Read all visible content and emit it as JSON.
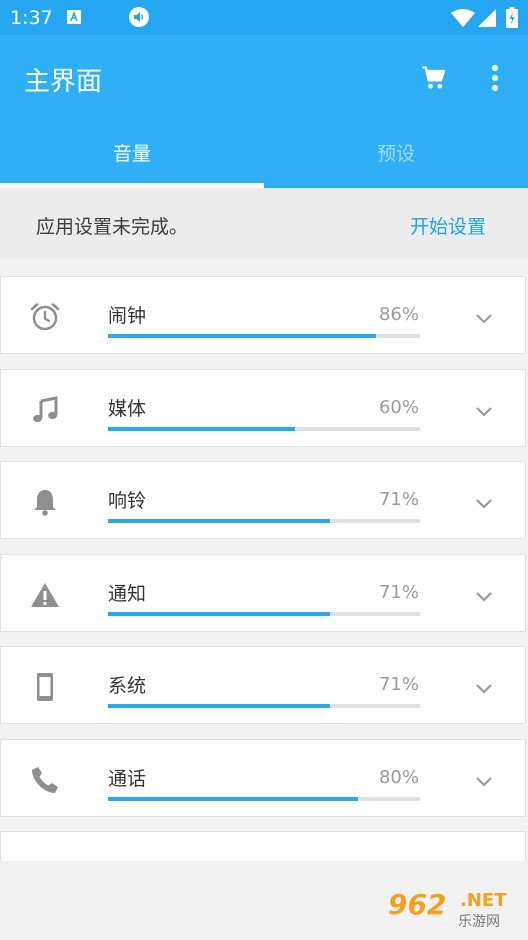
{
  "status_bar": {
    "time": "1:37",
    "accent": "#25a6f0",
    "icons": [
      "a-notification-icon",
      "volume-icon",
      "wifi-icon",
      "signal-icon",
      "battery-icon"
    ]
  },
  "app_bar": {
    "title": "主界面",
    "accent": "#2fb0f6",
    "actions": [
      "cart-icon",
      "more-vert-icon"
    ]
  },
  "tabs": [
    {
      "label": "音量",
      "selected": true
    },
    {
      "label": "预设",
      "selected": false
    }
  ],
  "setup_banner": {
    "message": "应用设置未完成。",
    "action": "开始设置"
  },
  "volume_items": [
    {
      "label": "闹钟",
      "percent_text": "86%",
      "level": 0.86,
      "icon": "alarm-icon"
    },
    {
      "label": "媒体",
      "percent_text": "60%",
      "level": 0.6,
      "icon": "music-note-icon"
    },
    {
      "label": "响铃",
      "percent_text": "71%",
      "level": 0.71,
      "icon": "bell-icon"
    },
    {
      "label": "通知",
      "percent_text": "71%",
      "level": 0.71,
      "icon": "warning-icon"
    },
    {
      "label": "系统",
      "percent_text": "71%",
      "level": 0.71,
      "icon": "phone-device-icon"
    },
    {
      "label": "通话",
      "percent_text": "80%",
      "level": 0.8,
      "icon": "phone-call-icon"
    }
  ],
  "watermark": {
    "brand": "962",
    "suffix": ".NET",
    "subtitle": "乐游网"
  }
}
